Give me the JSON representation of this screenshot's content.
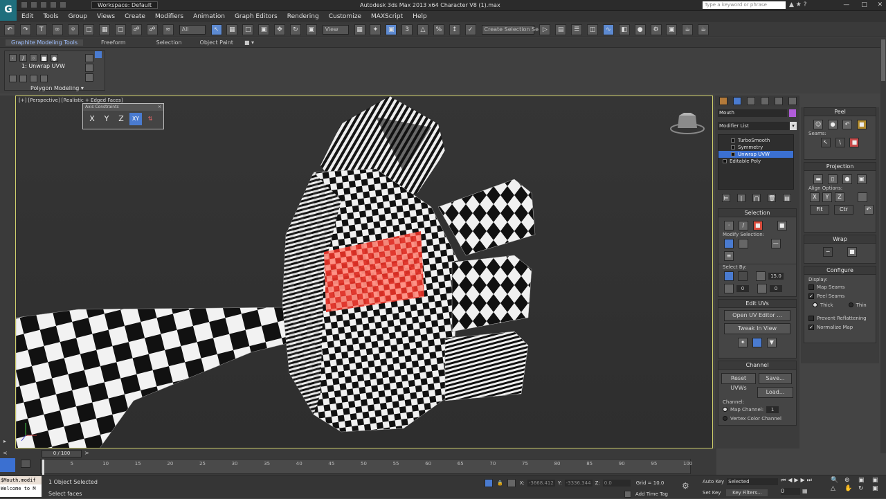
{
  "titlebar": {
    "workspace": "Workspace: Default",
    "title": "Autodesk 3ds Max  2013 x64      Character V8 (1).max",
    "search_placeholder": "Type a keyword or phrase"
  },
  "menu": [
    "Edit",
    "Tools",
    "Group",
    "Views",
    "Create",
    "Modifiers",
    "Animation",
    "Graph Editors",
    "Rendering",
    "Customize",
    "MAXScript",
    "Help"
  ],
  "toolbar": {
    "filter": "All",
    "view": "View",
    "selection_set": "Create Selection Se"
  },
  "ribbon": {
    "tabs": [
      "Graphite Modeling Tools",
      "Freeform",
      "Selection",
      "Object Paint"
    ],
    "stack_label": "1: Unwrap UVW",
    "panel_label": "Polygon Modeling"
  },
  "viewport": {
    "label": "[+] [Perspective] [Realistic + Edged Faces]",
    "axis_dialog_title": "Axis Constraints",
    "axis_buttons": [
      "X",
      "Y",
      "Z",
      "XY"
    ]
  },
  "command_panel": {
    "object_name": "Mouth",
    "modifier_list": "Modifier List",
    "stack": [
      "TurboSmooth",
      "Symmetry",
      "Unwrap UVW",
      "Editable Poly"
    ],
    "selection": {
      "title": "Selection",
      "modify_selection": "Modify Selection:",
      "select_by": "Select By:",
      "threshold": "15.0",
      "spin1": "0",
      "spin2": "0"
    },
    "edit_uvs": {
      "title": "Edit UVs",
      "open": "Open UV Editor ...",
      "tweak": "Tweak In View"
    },
    "channel": {
      "title": "Channel",
      "reset": "Reset UVWs",
      "save": "Save...",
      "load": "Load...",
      "channel_label": "Channel:",
      "map_channel": "Map Channel:",
      "map_channel_value": "1",
      "vertex_color": "Vertex Color Channel"
    }
  },
  "unwrap_panel": {
    "peel": {
      "title": "Peel",
      "seams": "Seams:"
    },
    "projection": {
      "title": "Projection",
      "align": "Align Options:",
      "axes": [
        "X",
        "Y",
        "Z"
      ]
    },
    "wrap": {
      "title": "Wrap"
    },
    "configure": {
      "title": "Configure",
      "display": "Display:",
      "map_seams": "Map Seams",
      "peel_seams": "Peel Seams",
      "thick": "Thick",
      "thin": "Thin",
      "prevent": "Prevent Reflattening",
      "normalize": "Normalize Map"
    }
  },
  "timeline": {
    "frame": "0 / 100",
    "ticks": [
      "5",
      "10",
      "15",
      "20",
      "25",
      "30",
      "35",
      "40",
      "45",
      "50",
      "55",
      "60",
      "65",
      "70",
      "75",
      "80",
      "85",
      "90",
      "95",
      "100"
    ]
  },
  "status": {
    "script1": "$Mouth.modif",
    "script2": "Welcome to M",
    "selected": "1 Object Selected",
    "prompt": "Select faces",
    "x": "-3668.412",
    "y": "-3336.344",
    "z": "0.0",
    "grid": "Grid = 10.0",
    "autokey": "Auto Key",
    "selected_mode": "Selected",
    "setkey": "Set Key",
    "keyfilters": "Key Filters...",
    "addtime": "Add Time Tag"
  }
}
